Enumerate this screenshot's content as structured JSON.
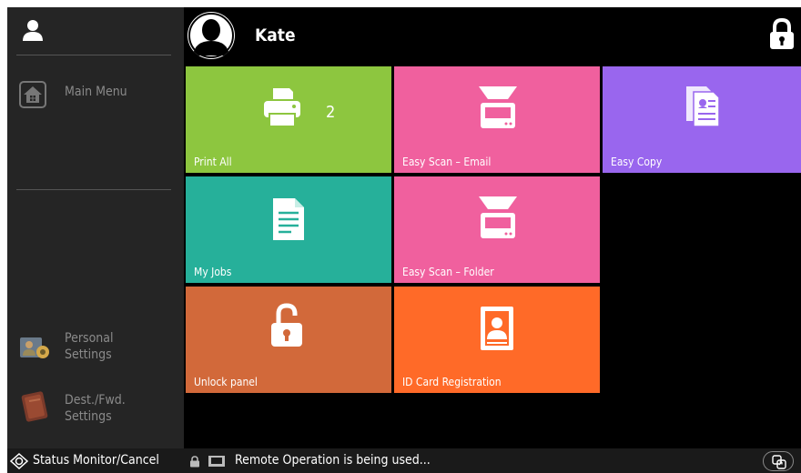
{
  "user": {
    "name": "Kate"
  },
  "sidebar": {
    "items": [
      {
        "label": "Main Menu",
        "icon": "home-icon"
      },
      {
        "label": "Personal\nSettings",
        "icon": "personal-settings-icon"
      },
      {
        "label": "Dest./Fwd.\nSettings",
        "icon": "address-book-icon"
      }
    ]
  },
  "tiles": [
    {
      "label": "Print All",
      "icon": "printer-icon",
      "count": "2",
      "color": "#8dc63f"
    },
    {
      "label": "Easy Scan – Email",
      "icon": "scanner-icon",
      "color": "#f0609e"
    },
    {
      "label": "Easy Copy",
      "icon": "copy-icon",
      "color": "#9966ee"
    },
    {
      "label": "My Jobs",
      "icon": "document-icon",
      "color": "#26b09a"
    },
    {
      "label": "Easy Scan – Folder",
      "icon": "scanner-icon",
      "color": "#f0609e"
    },
    {
      "label": "Unlock panel",
      "icon": "unlock-icon",
      "color": "#d2693a"
    },
    {
      "label": "ID Card Registration",
      "icon": "id-card-icon",
      "color": "#ff6a28"
    }
  ],
  "status_bar": {
    "status_button": "Status Monitor/Cancel",
    "message": "Remote Operation is being used..."
  },
  "colors": {
    "background": "#000000",
    "sidebar": "#252525"
  }
}
